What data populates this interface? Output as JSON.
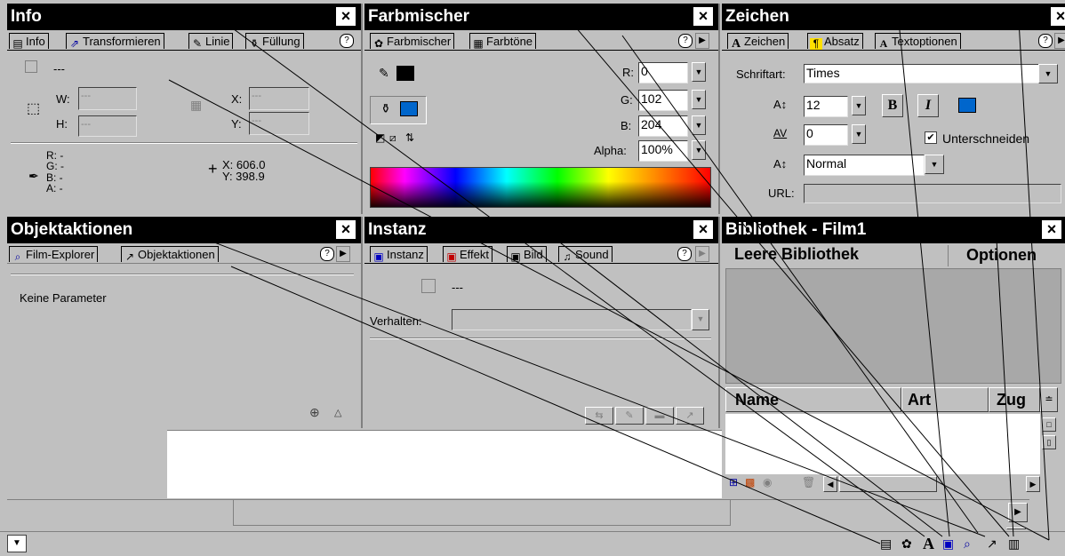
{
  "colors": {
    "titlebar": "#000000",
    "panel_bg": "#c0c0c0",
    "fill_blue": "#0066cc"
  },
  "info": {
    "title": "Info",
    "close": "×",
    "help": "?",
    "tabs": [
      {
        "label": "Info",
        "icon": "info-icon"
      },
      {
        "label": "Transformieren",
        "icon": "transform-icon"
      },
      {
        "label": "Linie",
        "icon": "pencil-icon"
      },
      {
        "label": "Füllung",
        "icon": "bucket-icon"
      }
    ],
    "instance_name": "---",
    "w_label": "W:",
    "w_value": "---",
    "h_label": "H:",
    "h_value": "---",
    "x_label": "X:",
    "x_value": "---",
    "y_label": "Y:",
    "y_value": "---",
    "r_line": "R: -",
    "g_line": "G: -",
    "b_line": "B: -",
    "a_line": "A: -",
    "cx_line": "X: 606.0",
    "cy_line": "Y: 398.9"
  },
  "mixer": {
    "title": "Farbmischer",
    "close": "×",
    "help": "?",
    "tabs": [
      {
        "label": "Farbmischer",
        "icon": "palette-icon"
      },
      {
        "label": "Farbtöne",
        "icon": "swatches-icon"
      }
    ],
    "r_label": "R:",
    "r_value": "0",
    "g_label": "G:",
    "g_value": "102",
    "b_label": "B:",
    "b_value": "204",
    "alpha_label": "Alpha:",
    "alpha_value": "100%"
  },
  "character": {
    "title": "Zeichen",
    "close": "×",
    "help": "?",
    "tabs": [
      {
        "label": "Zeichen",
        "icon": "character-icon"
      },
      {
        "label": "Absatz",
        "icon": "paragraph-icon"
      },
      {
        "label": "Textoptionen",
        "icon": "textoptions-icon"
      }
    ],
    "font_label": "Schriftart:",
    "font_value": "Times",
    "size_value": "12",
    "bold": "B",
    "italic": "I",
    "tracking_value": "0",
    "kerning_label": "Unterschneiden",
    "kerning_checked": "✔",
    "baseline_value": "Normal",
    "url_label": "URL:",
    "url_value": ""
  },
  "actions": {
    "title": "Objektaktionen",
    "close": "×",
    "help": "?",
    "tabs": [
      {
        "label": "Film-Explorer",
        "icon": "explorer-icon"
      },
      {
        "label": "Objektaktionen",
        "icon": "actions-icon"
      }
    ],
    "no_params": "Keine Parameter"
  },
  "instance": {
    "title": "Instanz",
    "close": "×",
    "help": "?",
    "tabs": [
      {
        "label": "Instanz",
        "icon": "instance-icon"
      },
      {
        "label": "Effekt",
        "icon": "effect-icon"
      },
      {
        "label": "Bild",
        "icon": "frame-icon"
      },
      {
        "label": "Sound",
        "icon": "sound-icon"
      }
    ],
    "name_value": "---",
    "behavior_label": "Verhalten:"
  },
  "library": {
    "title": "Bibliothek - Film1",
    "close": "×",
    "status": "Leere Bibliothek",
    "options": "Optionen",
    "col_name": "Name",
    "col_kind": "Art",
    "col_use": "Zug"
  }
}
